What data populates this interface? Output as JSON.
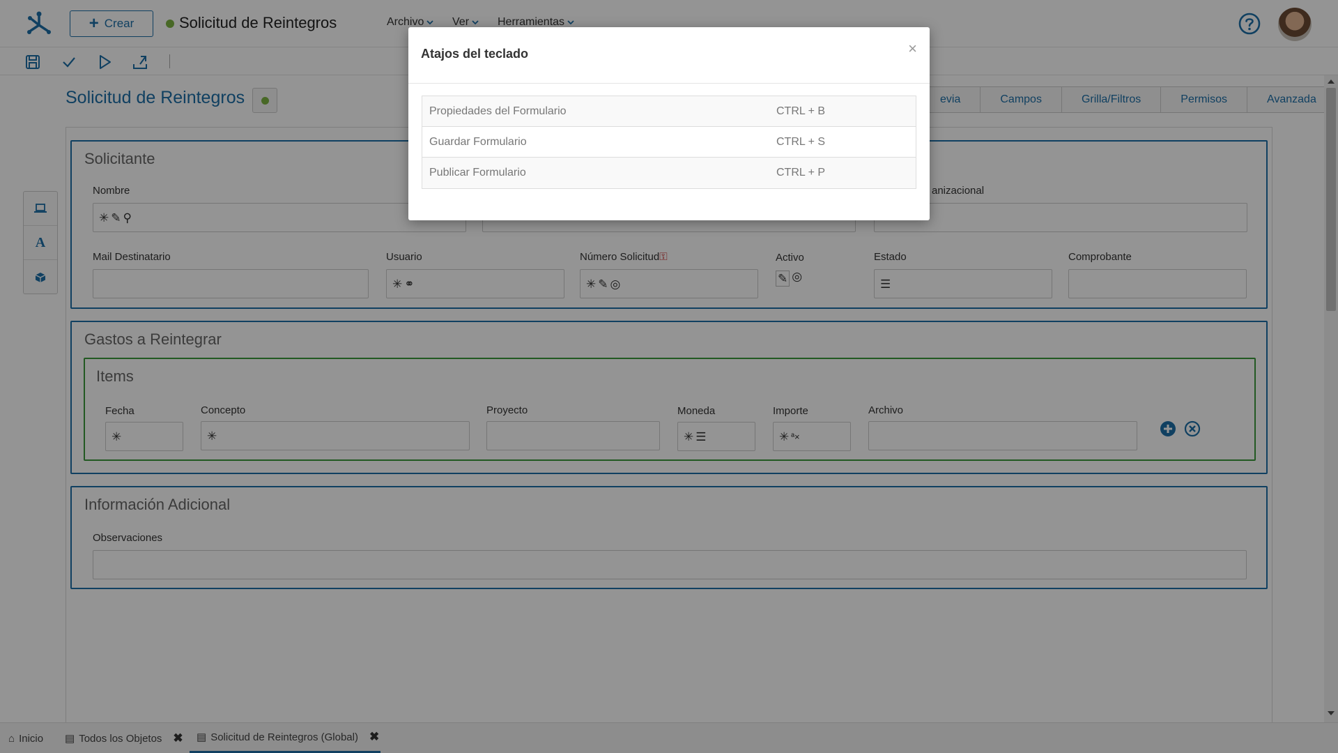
{
  "header": {
    "create_label": "Crear",
    "title": "Solicitud de Reintegros",
    "menus": [
      "Archivo",
      "Ver",
      "Herramientas"
    ]
  },
  "form": {
    "title": "Solicitud de Reintegros",
    "tabs": [
      "Vista Previa",
      "Campos",
      "Grilla/Filtros",
      "Permisos",
      "Avanzada"
    ],
    "tab_visible_text": [
      "evia",
      "Campos",
      "Grilla/Filtros",
      "Permisos",
      "Avanzada"
    ]
  },
  "sections": {
    "solicitante": {
      "title": "Solicitante",
      "labels": {
        "nombre": "Nombre",
        "unidad": "Unidad Organizacional",
        "unidad_visible": "anizacional",
        "mail": "Mail Destinatario",
        "usuario": "Usuario",
        "numero": "Número Solicitud",
        "activo": "Activo",
        "estado": "Estado",
        "comprobante": "Comprobante"
      }
    },
    "gastos": {
      "title": "Gastos a Reintegrar",
      "items": {
        "title": "Items",
        "labels": {
          "fecha": "Fecha",
          "concepto": "Concepto",
          "proyecto": "Proyecto",
          "moneda": "Moneda",
          "importe": "Importe",
          "archivo": "Archivo"
        }
      }
    },
    "adicional": {
      "title": "Información Adicional",
      "labels": {
        "observaciones": "Observaciones"
      }
    }
  },
  "bottom_tabs": [
    {
      "label": "Inicio"
    },
    {
      "label": "Todos los Objetos"
    },
    {
      "label": "Solicitud de Reintegros (Global)"
    }
  ],
  "modal": {
    "title": "Atajos del teclado",
    "close": "×",
    "shortcuts": [
      {
        "action": "Propiedades del Formulario",
        "keys": "CTRL + B"
      },
      {
        "action": "Guardar Formulario",
        "keys": "CTRL + S"
      },
      {
        "action": "Publicar Formulario",
        "keys": "CTRL + P"
      }
    ]
  },
  "colors": {
    "accent": "#1d6fa8",
    "status_green": "#7cb342",
    "items_border": "#3c9a3c",
    "key_red": "#c62828"
  }
}
